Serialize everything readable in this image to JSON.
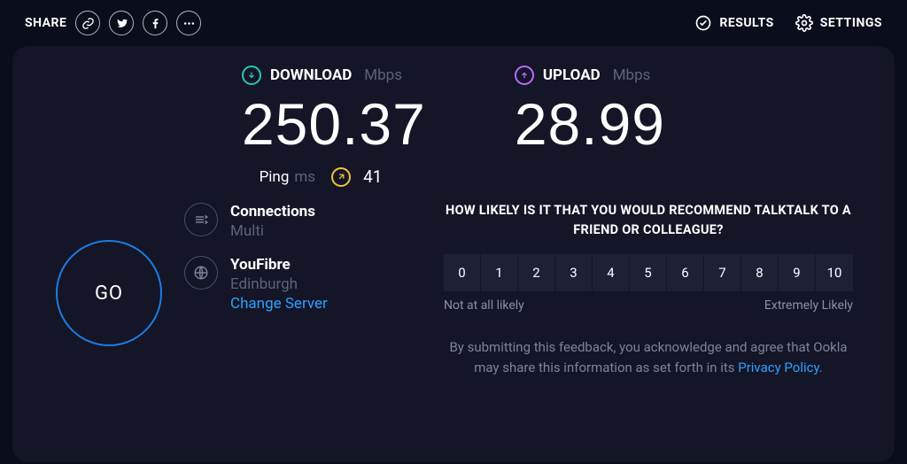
{
  "topbar": {
    "share_label": "SHARE",
    "results_label": "RESULTS",
    "settings_label": "SETTINGS"
  },
  "metrics": {
    "download": {
      "label": "DOWNLOAD",
      "unit": "Mbps",
      "value": "250.37"
    },
    "upload": {
      "label": "UPLOAD",
      "unit": "Mbps",
      "value": "28.99"
    }
  },
  "ping": {
    "label": "Ping",
    "unit": "ms",
    "value": "41"
  },
  "go": "GO",
  "connections": {
    "title": "Connections",
    "value": "Multi"
  },
  "server": {
    "isp": "YouFibre",
    "location": "Edinburgh",
    "change": "Change Server"
  },
  "survey": {
    "question": "HOW LIKELY IS IT THAT YOU WOULD RECOMMEND TALKTALK TO A FRIEND OR COLLEAGUE?",
    "scale": [
      "0",
      "1",
      "2",
      "3",
      "4",
      "5",
      "6",
      "7",
      "8",
      "9",
      "10"
    ],
    "low_label": "Not at all likely",
    "high_label": "Extremely Likely"
  },
  "disclaimer": {
    "prefix": "By submitting this feedback, you acknowledge and agree that Ookla may share this information as set forth in its ",
    "privacy": "Privacy Policy",
    "suffix": "."
  },
  "colors": {
    "accent_download": "#27c9b7",
    "accent_upload": "#b96bff",
    "accent_ping": "#f0c434",
    "link": "#2da0ff"
  }
}
